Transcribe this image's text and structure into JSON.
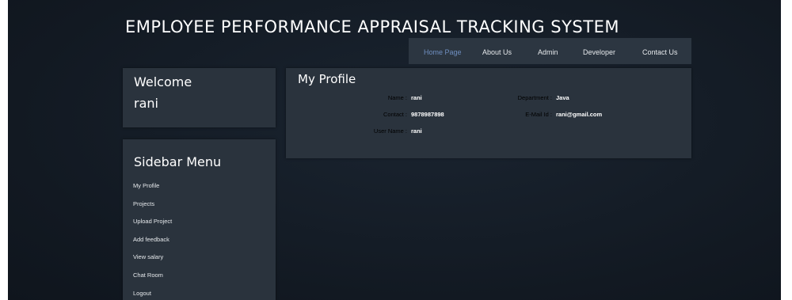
{
  "header": {
    "title": "EMPLOYEE PERFORMANCE APPRAISAL TRACKING SYSTEM"
  },
  "nav": {
    "items": [
      {
        "label": "Home Page",
        "active": true
      },
      {
        "label": "About Us"
      },
      {
        "label": "Admin"
      },
      {
        "label": "Developer"
      },
      {
        "label": "Contact Us"
      }
    ]
  },
  "welcome": {
    "title": "Welcome",
    "user": "rani"
  },
  "sidebar": {
    "title": "Sidebar Menu",
    "items": [
      {
        "label": "My Profile"
      },
      {
        "label": "Projects"
      },
      {
        "label": "Upload Project"
      },
      {
        "label": "Add feedback"
      },
      {
        "label": "View salary"
      },
      {
        "label": "Chat Room"
      },
      {
        "label": "Logout"
      }
    ]
  },
  "profile": {
    "title": "My Profile",
    "name_label": "Name :",
    "name": "rani",
    "contact_label": "Contact :",
    "contact": "9878987898",
    "username_label": "User Name :",
    "username": "rani",
    "department_label": "Department :",
    "department": "Java",
    "email_label": "E-Mail Id :",
    "email": "rani@gmail.com"
  },
  "colors": {
    "background": "#141c26",
    "panel": "#2a333d",
    "nav_active": "#6f8fc0"
  }
}
